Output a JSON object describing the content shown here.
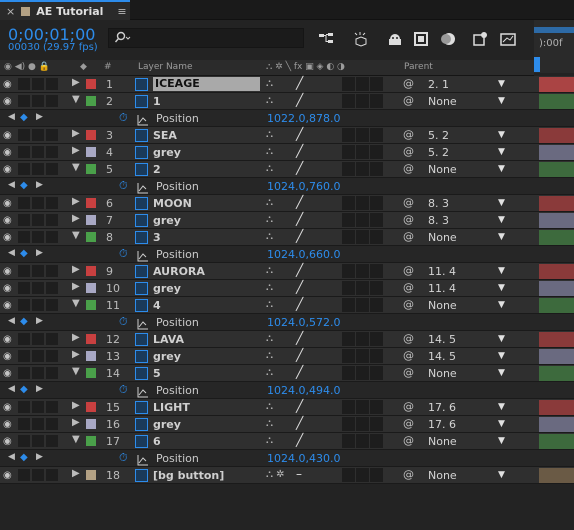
{
  "tab": {
    "title": "AE Tutorial",
    "close": "×",
    "menu": "≡"
  },
  "timecode": "0;00;01;00",
  "frame_info": "00030 (29.97 fps)",
  "search": {
    "placeholder": ""
  },
  "ruler": {
    "label": "):00f"
  },
  "header": {
    "hash": "#",
    "layer_name": "Layer Name",
    "parent": "Parent"
  },
  "colors": {
    "accent": "#2d8ceb",
    "red": "#c84040",
    "green": "#4aa04a",
    "grey": "#a8a8c4",
    "tan": "#b3a184"
  },
  "rows": [
    {
      "type": "layer",
      "num": "1",
      "name": "ICEAGE",
      "label": "red",
      "parent": "2. 1",
      "sel": true,
      "tl": "#a44"
    },
    {
      "type": "layer",
      "num": "2",
      "name": "1",
      "label": "green",
      "parent": "None",
      "open": true,
      "tl": "#3d6a3d"
    },
    {
      "type": "prop",
      "name": "Position",
      "value": "1022.0,878.0"
    },
    {
      "type": "layer",
      "num": "3",
      "name": "SEA",
      "label": "red",
      "parent": "5. 2",
      "tl": "#8a3a3a"
    },
    {
      "type": "layer",
      "num": "4",
      "name": "grey",
      "label": "grey",
      "parent": "5. 2",
      "tl": "#6a6a80"
    },
    {
      "type": "layer",
      "num": "5",
      "name": "2",
      "label": "green",
      "parent": "None",
      "open": true,
      "tl": "#3d6a3d"
    },
    {
      "type": "prop",
      "name": "Position",
      "value": "1024.0,760.0"
    },
    {
      "type": "layer",
      "num": "6",
      "name": "MOON",
      "label": "red",
      "parent": "8. 3",
      "tl": "#8a3a3a"
    },
    {
      "type": "layer",
      "num": "7",
      "name": "grey",
      "label": "grey",
      "parent": "8. 3",
      "tl": "#6a6a80"
    },
    {
      "type": "layer",
      "num": "8",
      "name": "3",
      "label": "green",
      "parent": "None",
      "open": true,
      "tl": "#3d6a3d"
    },
    {
      "type": "prop",
      "name": "Position",
      "value": "1024.0,660.0"
    },
    {
      "type": "layer",
      "num": "9",
      "name": "AURORA",
      "label": "red",
      "parent": "11. 4",
      "tl": "#8a3a3a"
    },
    {
      "type": "layer",
      "num": "10",
      "name": "grey",
      "label": "grey",
      "parent": "11. 4",
      "tl": "#6a6a80"
    },
    {
      "type": "layer",
      "num": "11",
      "name": "4",
      "label": "green",
      "parent": "None",
      "open": true,
      "tl": "#3d6a3d"
    },
    {
      "type": "prop",
      "name": "Position",
      "value": "1024.0,572.0"
    },
    {
      "type": "layer",
      "num": "12",
      "name": "LAVA",
      "label": "red",
      "parent": "14. 5",
      "tl": "#8a3a3a"
    },
    {
      "type": "layer",
      "num": "13",
      "name": "grey",
      "label": "grey",
      "parent": "14. 5",
      "tl": "#6a6a80"
    },
    {
      "type": "layer",
      "num": "14",
      "name": "5",
      "label": "green",
      "parent": "None",
      "open": true,
      "tl": "#3d6a3d"
    },
    {
      "type": "prop",
      "name": "Position",
      "value": "1024.0,494.0"
    },
    {
      "type": "layer",
      "num": "15",
      "name": "LIGHT",
      "label": "red",
      "parent": "17. 6",
      "tl": "#8a3a3a"
    },
    {
      "type": "layer",
      "num": "16",
      "name": "grey",
      "label": "grey",
      "parent": "17. 6",
      "tl": "#6a6a80"
    },
    {
      "type": "layer",
      "num": "17",
      "name": "6",
      "label": "green",
      "parent": "None",
      "open": true,
      "tl": "#3d6a3d"
    },
    {
      "type": "prop",
      "name": "Position",
      "value": "1024.0,430.0"
    },
    {
      "type": "layer",
      "num": "18",
      "name": "[bg button]",
      "label": "tan",
      "parent": "None",
      "bg": true,
      "tl": "#6a5a45"
    }
  ]
}
